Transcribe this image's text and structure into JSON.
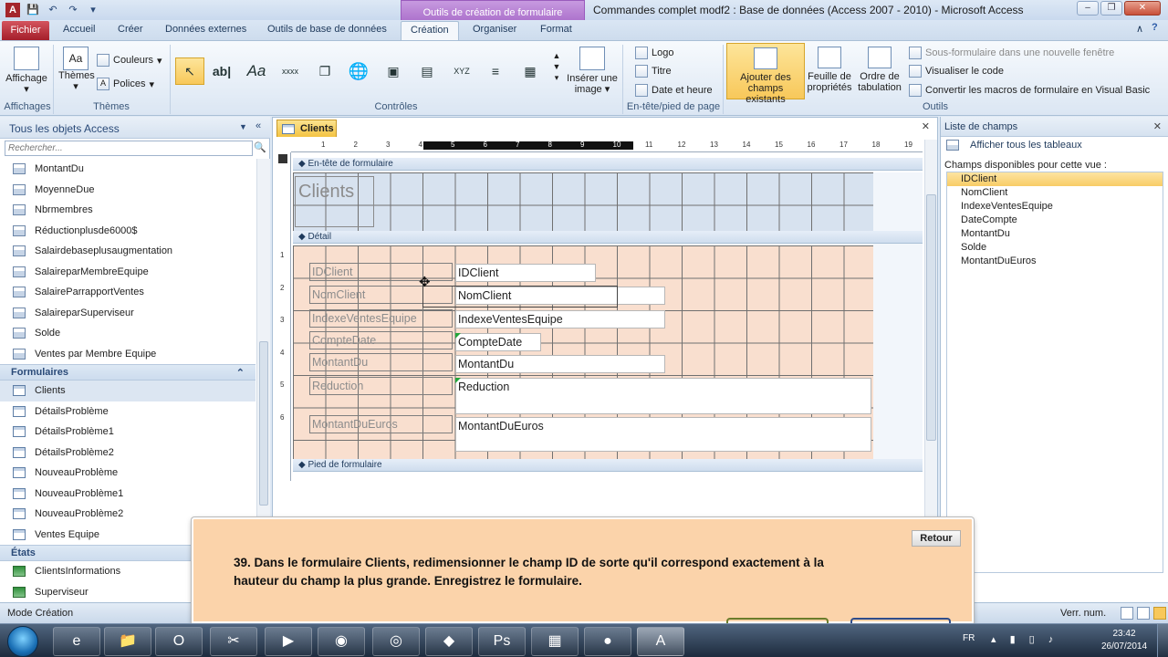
{
  "window": {
    "title": "Commandes complet modf2 : Base de données (Access 2007 - 2010)  -  Microsoft Access",
    "contextual_tab_title": "Outils de création de formulaire"
  },
  "tabs": {
    "file": "Fichier",
    "items": [
      "Accueil",
      "Créer",
      "Données externes",
      "Outils de base de données",
      "Création",
      "Organiser",
      "Format"
    ],
    "active": "Création"
  },
  "ribbon": {
    "affichage": {
      "label": "Affichage",
      "group": "Affichages"
    },
    "themes": {
      "label": "Thèmes",
      "couleurs": "Couleurs",
      "polices": "Polices",
      "group": "Thèmes"
    },
    "controles": {
      "group": "Contrôles",
      "inserer_image": "Insérer une image",
      "icons": [
        "pointer-icon",
        "textbox-icon",
        "label-icon",
        "button-icon",
        "tab-control-icon",
        "hyperlink-icon",
        "web-browser-icon",
        "navigation-icon",
        "option-group-icon",
        "page-break-icon",
        "combo-box-icon"
      ]
    },
    "entete": {
      "logo": "Logo",
      "titre": "Titre",
      "date_heure": "Date et heure",
      "group": "En-tête/pied de page"
    },
    "outils": {
      "ajouter": "Ajouter des champs existants",
      "feuille": "Feuille de propriétés",
      "ordre": "Ordre de tabulation",
      "sous_form": "Sous-formulaire dans une nouvelle fenêtre",
      "visualiser": "Visualiser le code",
      "convertir": "Convertir les macros de formulaire en Visual Basic",
      "group": "Outils"
    }
  },
  "nav": {
    "title": "Tous les objets Access",
    "search_placeholder": "Rechercher...",
    "queries": [
      "MontantDu",
      "MoyenneDue",
      "Nbrmembres",
      "Réductionplusde6000$",
      "Salairdebaseplusaugmentation",
      "SalaireparMembreEquipe",
      "SalaireParrapportVentes",
      "SalaireparSuperviseur",
      "Solde",
      "Ventes par Membre Equipe"
    ],
    "forms_section": "Formulaires",
    "forms": [
      "Clients",
      "DétailsProblème",
      "DétailsProblème1",
      "DétailsProblème2",
      "NouveauProblème",
      "NouveauProblème1",
      "NouveauProblème2",
      "Ventes Equipe"
    ],
    "reports_section": "États",
    "reports": [
      "ClientsInformations",
      "Superviseur"
    ]
  },
  "document": {
    "tab_label": "Clients",
    "section_header": "En-tête de formulaire",
    "section_detail": "Détail",
    "section_footer": "Pied de formulaire",
    "form_title": "Clients",
    "ruler_top": [
      "1",
      "2",
      "3",
      "4",
      "5",
      "6",
      "7",
      "8",
      "9",
      "10",
      "11",
      "12",
      "13",
      "14",
      "15",
      "16",
      "17",
      "18",
      "19"
    ],
    "ruler_left": [
      "1",
      "2",
      "3",
      "4",
      "5",
      "6"
    ],
    "fields": [
      {
        "label": "IDClient",
        "control": "IDClient"
      },
      {
        "label": "NomClient",
        "control": "NomClient"
      },
      {
        "label": "IndexeVentesEquipe",
        "control": "IndexeVentesEquipe"
      },
      {
        "label": "CompteDate",
        "control": "CompteDate"
      },
      {
        "label": "MontantDu",
        "control": "MontantDu"
      },
      {
        "label": "Reduction",
        "control": "Reduction"
      },
      {
        "label": "MontantDuEuros",
        "control": "MontantDuEuros"
      }
    ]
  },
  "field_list": {
    "title": "Liste de champs",
    "show_all": "Afficher tous les tableaux",
    "available": "Champs disponibles pour cette vue :",
    "fields": [
      "IDClient",
      "NomClient",
      "IndexeVentesEquipe",
      "DateCompte",
      "MontantDu",
      "Solde",
      "MontantDuEuros"
    ],
    "selected": "IDClient"
  },
  "status": {
    "mode": "Mode Création",
    "num_lock": "Verr. num."
  },
  "instruction": {
    "back_button": "Retour",
    "text": "39. Dans le formulaire Clients, redimensionner le champ ID de sorte qu'il correspond exactement à la hauteur du champ la plus grande. Enregistrez le formulaire."
  },
  "taskbar": {
    "lang": "FR",
    "time": "23:42",
    "date": "26/07/2014"
  }
}
